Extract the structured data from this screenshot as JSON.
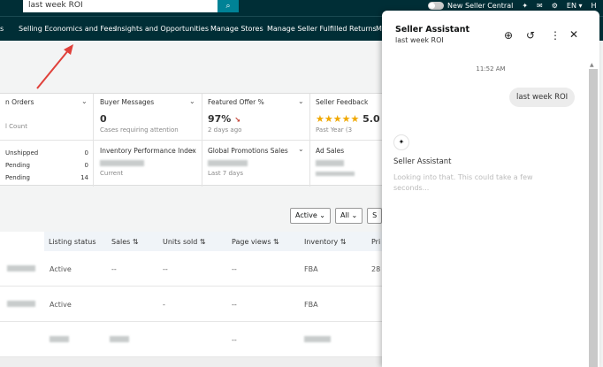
{
  "search": {
    "value": "last week ROI"
  },
  "topbar": {
    "toggle_label": "New Seller Central",
    "lang": "EN ▾",
    "extra": "H"
  },
  "nav": [
    "s",
    "Selling Economics and Fees",
    "Insights and Opportunities",
    "Manage Stores",
    "Manage Seller Fulfilled Returns",
    "M"
  ],
  "cards": {
    "orders": {
      "title": "n Orders",
      "sub": "l Count",
      "rows": [
        {
          "l": "Unshipped",
          "v": "0"
        },
        {
          "l": "Pending",
          "v": "0"
        },
        {
          "l": "Pending",
          "v": "14"
        }
      ]
    },
    "buyer": {
      "title": "Buyer Messages",
      "value": "0",
      "sub": "Cases requiring attention"
    },
    "offer": {
      "title": "Featured Offer %",
      "value": "97%",
      "sub": "2 days ago"
    },
    "feedback": {
      "title": "Seller Feedback",
      "stars": "★★★★★",
      "value": "5.0",
      "sub": "Past Year (3"
    },
    "ipi": {
      "title": "Inventory Performance Index",
      "sub": "Current"
    },
    "promo": {
      "title": "Global Promotions Sales",
      "sub": "Last 7 days"
    },
    "ads": {
      "title": "Ad Sales"
    }
  },
  "filters": [
    "Active",
    "All",
    "S"
  ],
  "table": {
    "headers": [
      "Listing status",
      "Sales",
      "Units sold",
      "Page views",
      "Inventory",
      "Pri"
    ],
    "rows": [
      [
        "Active",
        "--",
        "--",
        "--",
        "FBA",
        "28"
      ],
      [
        "Active",
        "",
        "-",
        "--",
        "FBA",
        ""
      ],
      [
        "",
        "",
        "",
        "--",
        "",
        ""
      ]
    ]
  },
  "assistant": {
    "title": "Seller Assistant",
    "subtitle": "last week ROI",
    "time": "11:52 AM",
    "user_msg": "last week ROI",
    "bot_name": "Seller Assistant",
    "bot_msg": "Looking into that. This could take a few seconds..."
  }
}
